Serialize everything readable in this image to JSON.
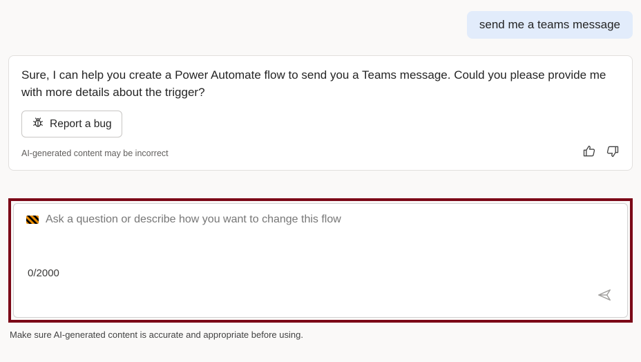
{
  "user_message": "send me a teams message",
  "assistant_message": "Sure, I can help you create a Power Automate flow to send you a Teams message. Could you please provide me with more details about the trigger?",
  "report_button_label": "Report a bug",
  "ai_disclaimer": "AI-generated content may be incorrect",
  "input": {
    "placeholder": "Ask a question or describe how you want to change this flow",
    "counter": "0/2000"
  },
  "footer_note": "Make sure AI-generated content is accurate and appropriate before using."
}
